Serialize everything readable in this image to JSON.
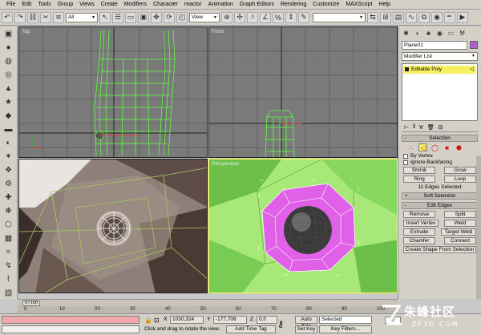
{
  "menu": [
    "File",
    "Edit",
    "Tools",
    "Group",
    "Views",
    "Create",
    "Modifiers",
    "Character",
    "reactor",
    "Animation",
    "Graph Editors",
    "Rendering",
    "Customize",
    "MAXScript",
    "Help"
  ],
  "toolbar": {
    "filter_value": "All",
    "refcoord_value": "View"
  },
  "viewports": {
    "top": "Top",
    "front": "Front",
    "left": "Left",
    "perspective": "Perspective"
  },
  "command_panel": {
    "object_name": "Plane01",
    "object_color": "#b060d0",
    "modifier_list": "Modifier List",
    "stack_item": "Editable Poly",
    "selection_title": "Selection",
    "by_vertex": "By Vertex",
    "ignore_backfacing": "Ignore Backfacing",
    "shrink": "Shrink",
    "grow": "Grow",
    "ring": "Ring",
    "loop": "Loop",
    "selection_status": "11 Edges Selected",
    "soft_selection_title": "Soft Selection",
    "edit_edges_title": "Edit Edges",
    "remove": "Remove",
    "split": "Split",
    "insert_vertex": "Insert Vertex",
    "weld": "Weld",
    "extrude": "Extrude",
    "target_weld": "Target Weld",
    "chamfer": "Chamfer",
    "connect": "Connect",
    "create_shape": "Create Shape From Selection"
  },
  "timeline": {
    "slider_label": "0 / 100",
    "ticks": [
      "0",
      "10",
      "20",
      "30",
      "40",
      "50",
      "60",
      "70",
      "80",
      "90",
      "100"
    ]
  },
  "status": {
    "x_label": "X",
    "x_value": "1030,324",
    "y_label": "Y",
    "y_value": "-177,708",
    "z_label": "Z",
    "z_value": "0,0",
    "prompt": "Click and drag to rotate the view.",
    "add_time_tag": "Add Time Tag",
    "auto_key": "Auto Key",
    "set_key": "Set Key",
    "selected": "Selected",
    "key_filters": "Key Filters...",
    "frame": "0"
  },
  "watermark": {
    "brand_cn": "朱峰社区",
    "brand_url": "ZF3D.COM"
  },
  "colors": {
    "wire_green": "#5cff3c",
    "selected_yellow": "#ffff40",
    "perspective_bg": "#a8e878",
    "poly_pink": "#e060e8"
  }
}
